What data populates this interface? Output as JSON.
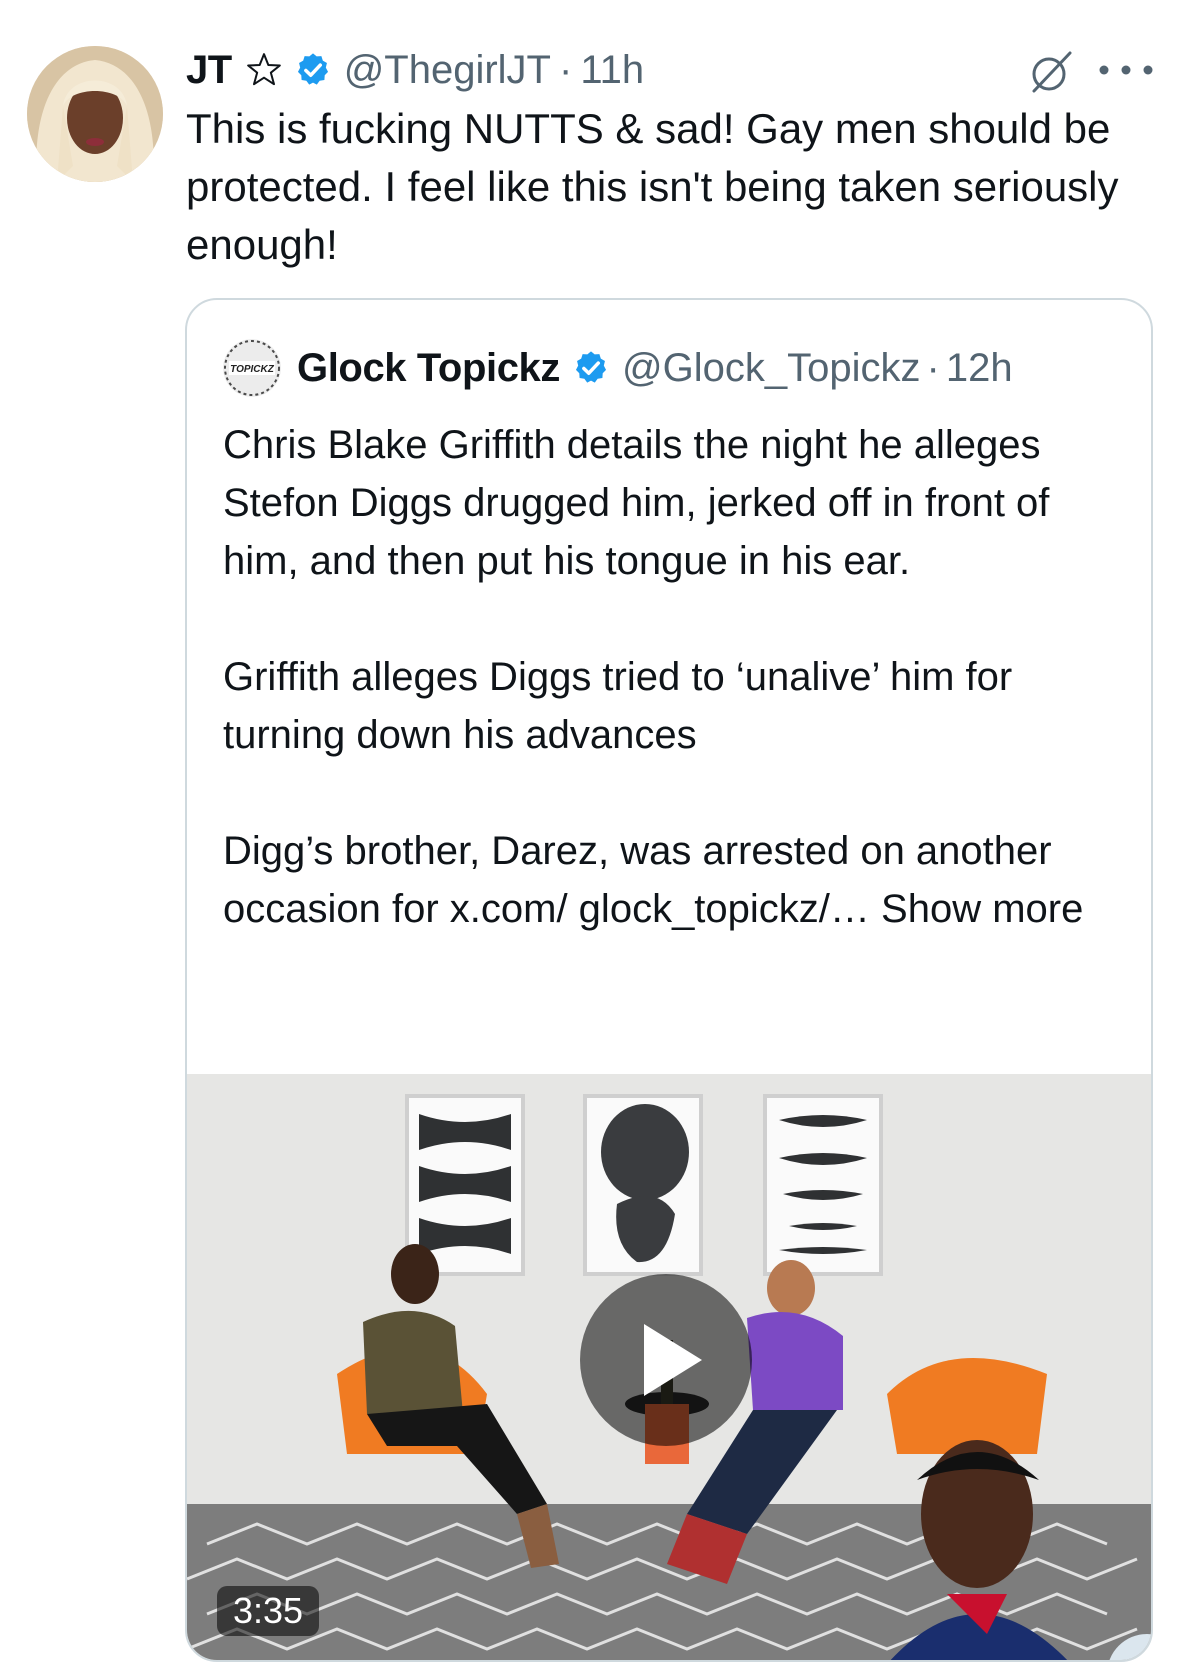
{
  "tweet": {
    "author_name": "JT",
    "author_handle": "@ThegirlJT",
    "separator": "·",
    "time": "11h",
    "text": "This is fucking NUTTS & sad! Gay men should be protected. I feel like this isn't being taken seriously enough!"
  },
  "quote": {
    "author_name": "Glock Topickz",
    "author_handle": "@Glock_Topickz",
    "separator": "·",
    "time": "12h",
    "avatar_text": "TOPICKZ",
    "paragraphs": [
      "Chris Blake Griffith details the night he alleges Stefon Diggs drugged him, jerked off in front of him, and then put his tongue in his ear.",
      "Griffith alleges Diggs tried to ‘unalive’ him for turning down his advances",
      "Digg’s brother, Darez, was arrested on another occasion for x.com/ glock_topickz/…"
    ],
    "show_more": "Show more",
    "video_duration": "3:35"
  },
  "icons": {
    "star": "star-outline-icon",
    "verified": "verified-badge-icon",
    "grok": "grok-icon",
    "more": "more-horizontal-icon",
    "play": "play-icon"
  },
  "colors": {
    "verified_blue": "#1d9bf0",
    "secondary_text": "#536471",
    "border": "#cfd9de"
  }
}
